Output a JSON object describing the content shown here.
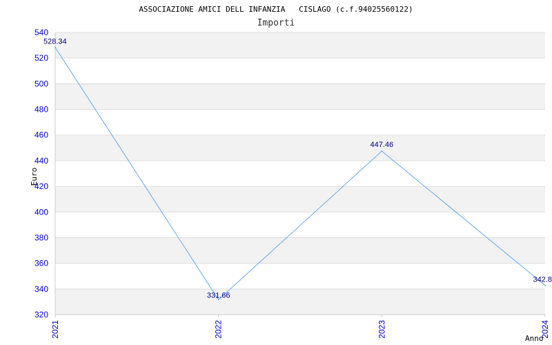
{
  "chart_data": {
    "type": "line",
    "title": "ASSOCIAZIONE AMICI DELL INFANZIA   CISLAGO (c.f.94025560122)",
    "subtitle": "Importi",
    "xlabel": "Anno",
    "ylabel": "Euro",
    "categories": [
      "2021",
      "2022",
      "2023",
      "2024"
    ],
    "series": [
      {
        "values": [
          528.34,
          331.66,
          447.46,
          342.8
        ],
        "labels": [
          "528.34",
          "331.66",
          "447.46",
          "342.8"
        ]
      }
    ],
    "ylim": [
      320,
      540
    ],
    "yticks": [
      320,
      340,
      360,
      380,
      400,
      420,
      440,
      460,
      480,
      500,
      520,
      540
    ],
    "grid": true,
    "colors": {
      "line": "#66aaee",
      "band": "#f2f2f2",
      "grid": "#dddddd",
      "tick_text": "#0000cc",
      "label_text": "#000080"
    }
  }
}
